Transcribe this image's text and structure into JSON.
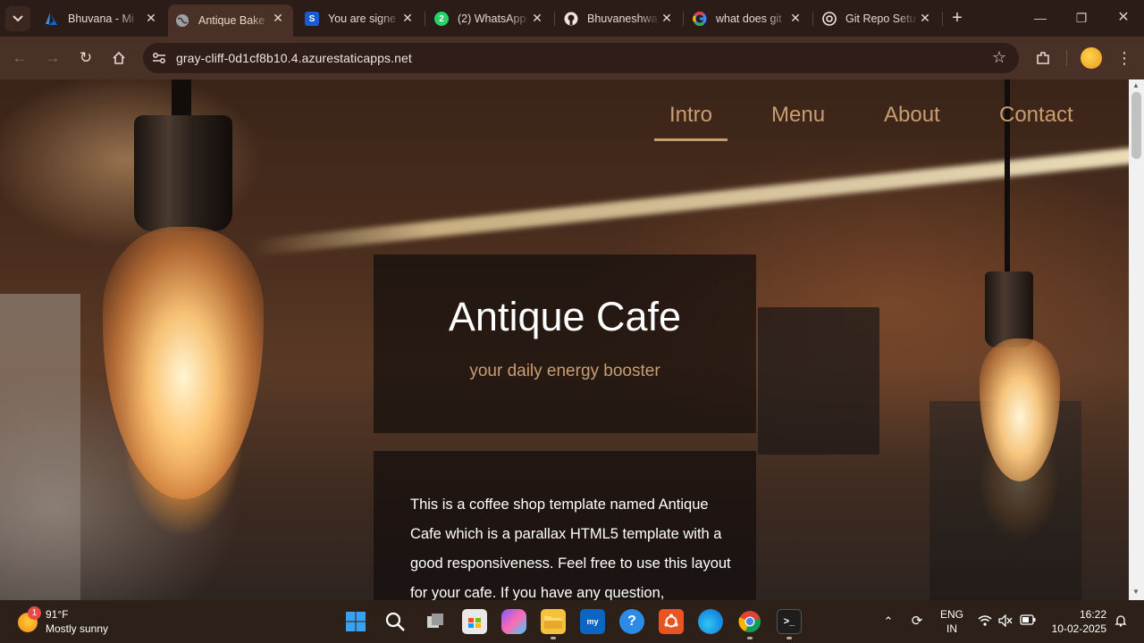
{
  "browser": {
    "tabs": [
      {
        "title": "Bhuvana - Mi",
        "icon": "azure-icon",
        "active": false
      },
      {
        "title": "Antique Bake",
        "icon": "globe-icon",
        "active": true
      },
      {
        "title": "You are signe",
        "icon": "s-logo-icon",
        "active": false
      },
      {
        "title": "(2) WhatsApp",
        "icon": "whatsapp-icon",
        "active": false
      },
      {
        "title": "Bhuvaneshwa",
        "icon": "github-icon",
        "active": false
      },
      {
        "title": "what does git",
        "icon": "google-icon",
        "active": false
      },
      {
        "title": "Git Repo Setu",
        "icon": "chatgpt-icon",
        "active": false
      }
    ],
    "url": "gray-cliff-0d1cf8b10.4.azurestaticapps.net"
  },
  "site": {
    "nav": [
      {
        "label": "Intro",
        "active": true
      },
      {
        "label": "Menu",
        "active": false
      },
      {
        "label": "About",
        "active": false
      },
      {
        "label": "Contact",
        "active": false
      }
    ],
    "hero": {
      "title": "Antique Cafe",
      "subtitle": "your daily energy booster"
    },
    "intro": {
      "text": "This is a coffee shop template named Antique Cafe which is a parallax HTML5 template with a good responsiveness. Feel free to use this layout for your cafe. If you have any question,"
    },
    "accent_color": "#c99d72"
  },
  "taskbar": {
    "weather": {
      "temp": "91°F",
      "desc": "Mostly sunny",
      "badge": "1"
    },
    "apps": [
      "start-icon",
      "search-icon",
      "task-view-icon",
      "store-icon",
      "copilot-icon",
      "file-explorer-icon",
      "myhp-icon",
      "help-icon",
      "ubuntu-icon",
      "edge-icon",
      "chrome-icon",
      "terminal-icon"
    ],
    "tray": {
      "lang_top": "ENG",
      "lang_bottom": "IN",
      "time": "16:22",
      "date": "10-02-2025"
    }
  }
}
